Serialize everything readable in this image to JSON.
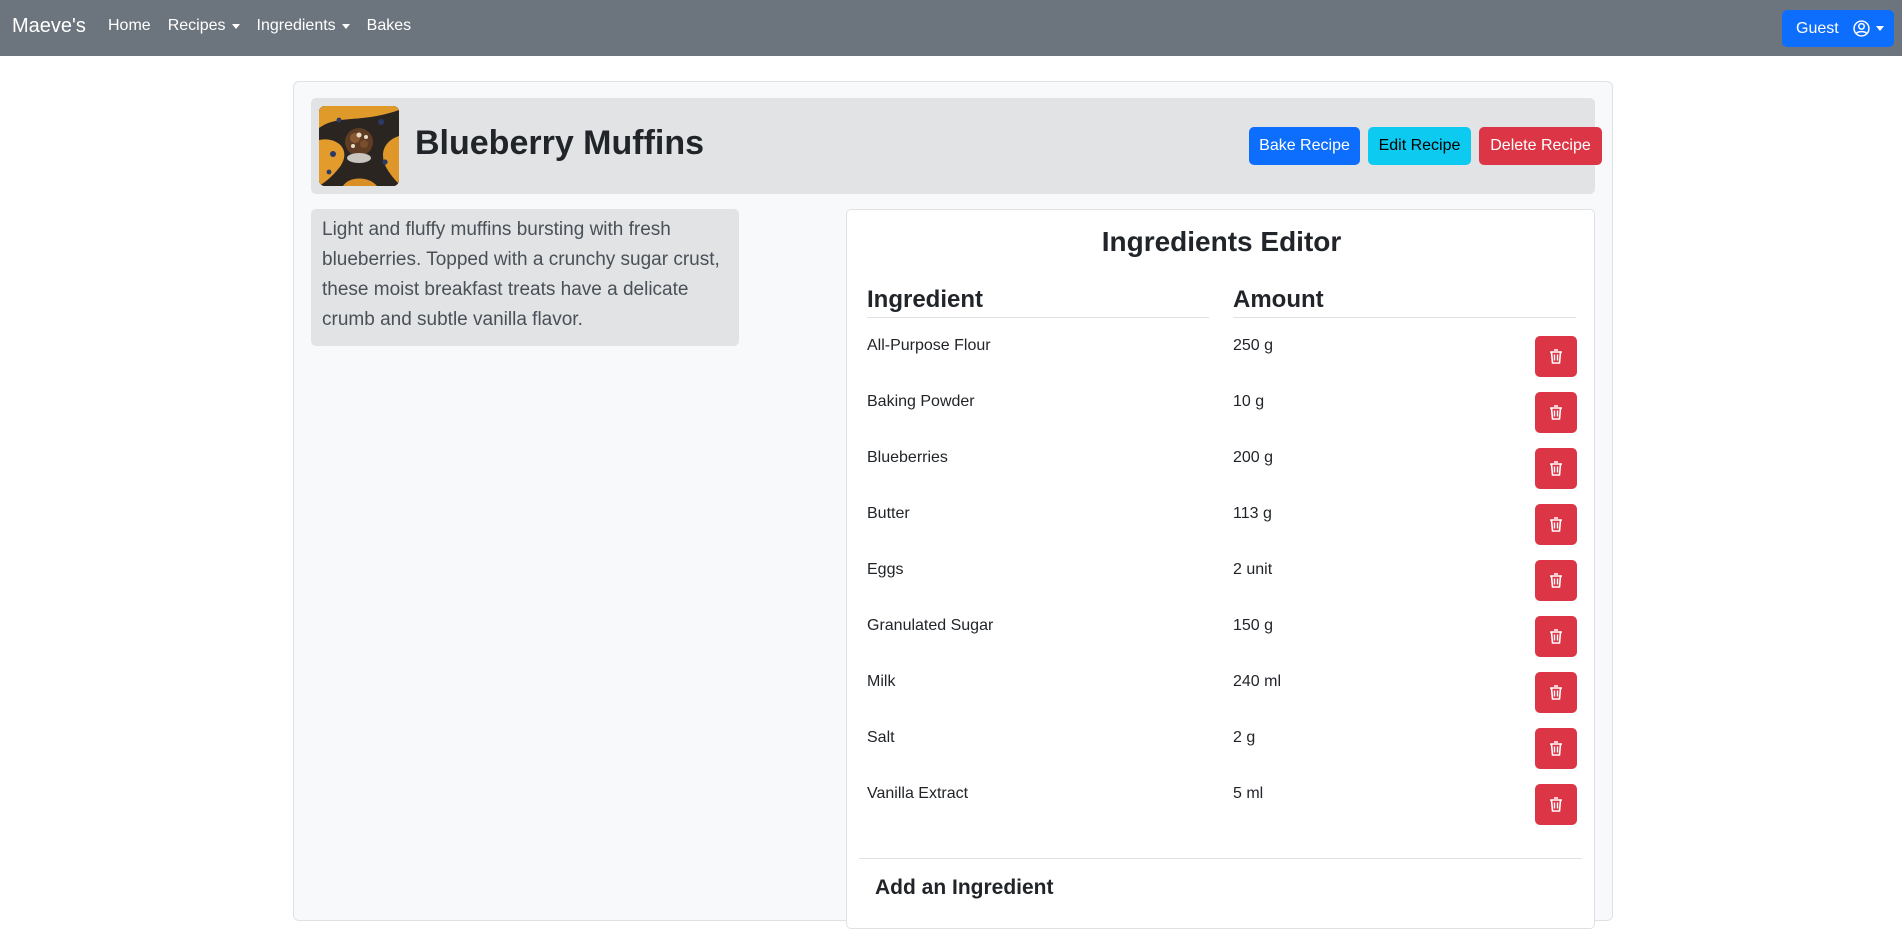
{
  "nav": {
    "brand": "Maeve's",
    "links": [
      {
        "label": "Home",
        "dropdown": false
      },
      {
        "label": "Recipes",
        "dropdown": true
      },
      {
        "label": "Ingredients",
        "dropdown": true
      },
      {
        "label": "Bakes",
        "dropdown": false
      }
    ],
    "user_label": "Guest",
    "user_icon": "person-circle-icon"
  },
  "recipe": {
    "title": "Blueberry Muffins",
    "image_icon": "muffin-photo",
    "description": "Light and fluffy muffins bursting with fresh blueberries. Topped with a crunchy sugar crust, these moist breakfast treats have a delicate crumb and subtle vanilla flavor.",
    "buttons": {
      "bake": "Bake Recipe",
      "edit": "Edit Recipe",
      "delete": "Delete Recipe"
    }
  },
  "editor": {
    "title": "Ingredients Editor",
    "col_ingredient": "Ingredient",
    "col_amount": "Amount",
    "rows": [
      {
        "name": "All-Purpose Flour",
        "amount": "250 g"
      },
      {
        "name": "Baking Powder",
        "amount": "10 g"
      },
      {
        "name": "Blueberries",
        "amount": "200 g"
      },
      {
        "name": "Butter",
        "amount": "113 g"
      },
      {
        "name": "Eggs",
        "amount": "2 unit"
      },
      {
        "name": "Granulated Sugar",
        "amount": "150 g"
      },
      {
        "name": "Milk",
        "amount": "240 ml"
      },
      {
        "name": "Salt",
        "amount": "2 g"
      },
      {
        "name": "Vanilla Extract",
        "amount": "5 ml"
      }
    ],
    "delete_icon": "trash-icon",
    "add_title": "Add an Ingredient"
  },
  "colors": {
    "navbar": "#6c757d",
    "primary": "#0d6efd",
    "info": "#0dcaf0",
    "danger": "#dc3545"
  }
}
